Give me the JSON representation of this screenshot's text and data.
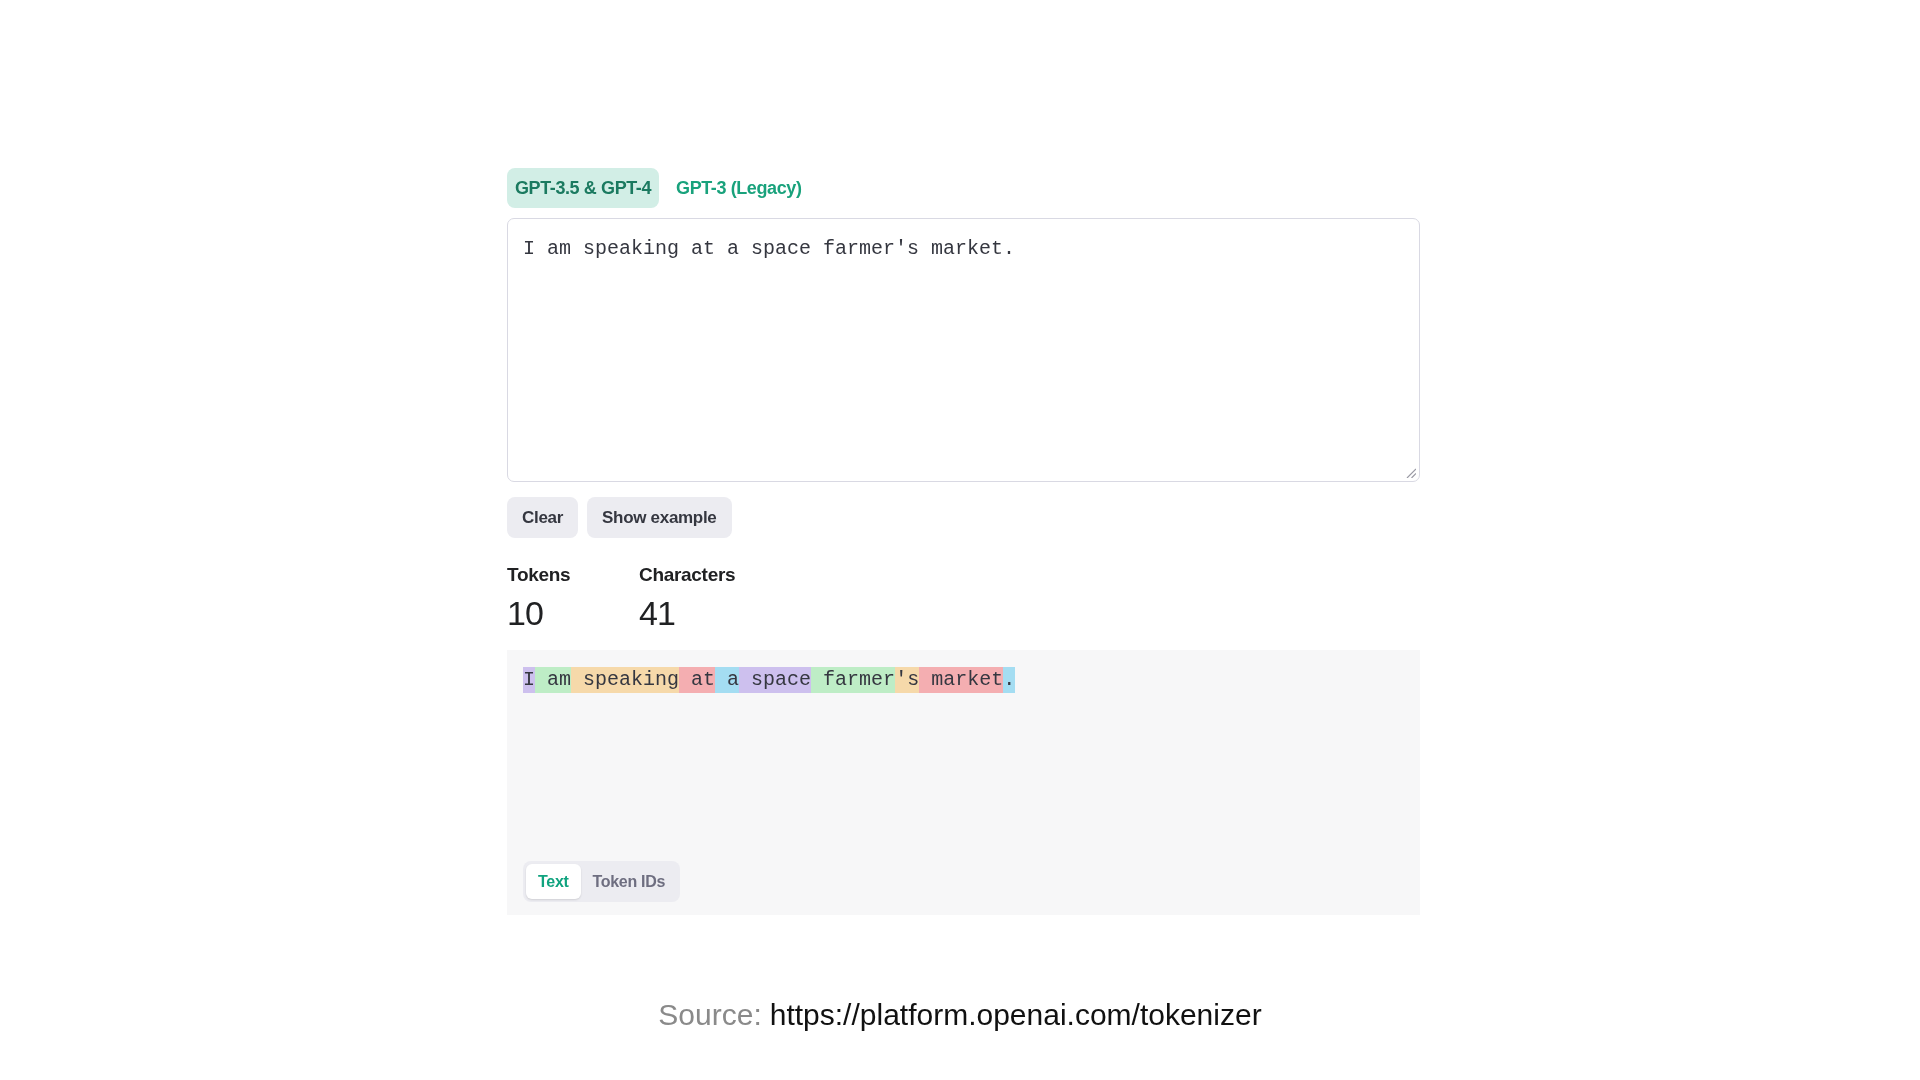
{
  "model_tabs": [
    {
      "label": "GPT-3.5 & GPT-4",
      "selected": true
    },
    {
      "label": "GPT-3 (Legacy)",
      "selected": false
    }
  ],
  "input": {
    "value": "I am speaking at a space farmer's market."
  },
  "actions": [
    "Clear",
    "Show example"
  ],
  "stats": [
    {
      "label": "Tokens",
      "value": "10"
    },
    {
      "label": "Characters",
      "value": "41"
    }
  ],
  "tokens": [
    {
      "text": "I",
      "color": "#cdc0ee"
    },
    {
      "text": " am",
      "color": "#beedc6"
    },
    {
      "text": " speaking",
      "color": "#f6d9aa"
    },
    {
      "text": " at",
      "color": "#f4aeb1"
    },
    {
      "text": " a",
      "color": "#a4ddf2"
    },
    {
      "text": " space",
      "color": "#cdc0ee"
    },
    {
      "text": " farmer",
      "color": "#beedc6"
    },
    {
      "text": "'s",
      "color": "#f6d9aa"
    },
    {
      "text": " market",
      "color": "#f4aeb1"
    },
    {
      "text": ".",
      "color": "#a4ddf2"
    }
  ],
  "view_toggle": [
    {
      "label": "Text",
      "selected": true
    },
    {
      "label": "Token IDs",
      "selected": false
    }
  ],
  "source": {
    "label": "Source:",
    "url": "https://platform.openai.com/tokenizer"
  }
}
